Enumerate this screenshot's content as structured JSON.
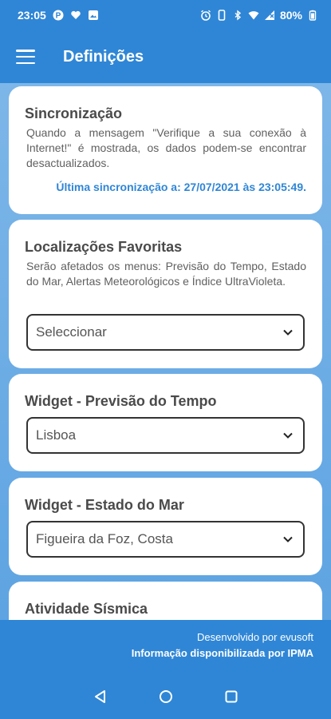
{
  "status_bar": {
    "time": "23:05",
    "battery": "80%",
    "icons": [
      "parking-icon",
      "heart-icon",
      "image-icon",
      "alarm-icon",
      "phone-icon",
      "bluetooth-icon",
      "wifi-icon",
      "signal-icon",
      "battery-icon"
    ]
  },
  "app_bar": {
    "title": "Definições",
    "menu_icon": "hamburger-menu-icon"
  },
  "cards": {
    "sync": {
      "title": "Sincronização",
      "description": "Quando a mensagem \"Verifique a sua conexão à Internet!\" é mostrada, os dados podem-se encontrar desactualizados.",
      "last_sync": "Última sincronização a: 27/07/2021 às 23:05:49."
    },
    "favorites": {
      "title": "Localizações Favoritas",
      "description": "Serão afetados os menus: Previsão do Tempo, Estado do Mar, Alertas Meteorológicos e Índice UltraVioleta.",
      "select_value": "Seleccionar"
    },
    "widget_weather": {
      "title": "Widget - Previsão do Tempo",
      "select_value": "Lisboa"
    },
    "widget_sea": {
      "title": "Widget - Estado do Mar",
      "select_value": "Figueira da Foz, Costa"
    },
    "seismic": {
      "title": "Atividade Sísmica"
    }
  },
  "footer": {
    "developed_by": "Desenvolvido por evusoft",
    "info_by": "Informação disponibilizada por IPMA"
  },
  "colors": {
    "primary": "#2f86d6",
    "accent_text": "#2f86d6",
    "card_bg": "#ffffff"
  }
}
